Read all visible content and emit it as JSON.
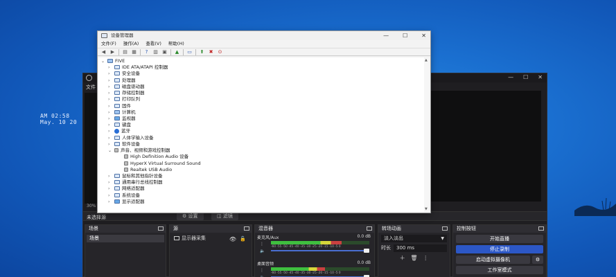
{
  "desktop": {
    "clock_time": "AM 02:58",
    "clock_date": "May. 10 20"
  },
  "obs": {
    "menu_file": "文件",
    "zoom": "30%",
    "no_source_selected": "未选择源",
    "properties_button": "设置",
    "filters_button": "滤镜",
    "docks": {
      "scenes": {
        "title": "场景",
        "items": [
          "场景"
        ]
      },
      "sources": {
        "title": "源",
        "items": [
          "显示器采集"
        ]
      },
      "mixer": {
        "title": "混音器",
        "channels": [
          {
            "name": "麦克风/Aux",
            "db": "0.0 dB",
            "level": 0.72
          },
          {
            "name": "桌面音频",
            "db": "0.0 dB",
            "level": 0.55
          }
        ],
        "scale": "-60 -55 -50 -45 -40 -35 -30 -25 -20 -15 -10 -5 0"
      },
      "transitions": {
        "title": "转场动画",
        "selected": "淡入淡出",
        "duration_label": "时长",
        "duration_value": "300 ms"
      },
      "controls": {
        "title": "控制按钮",
        "start_streaming": "开始直播",
        "stop_recording": "停止录制",
        "start_virtual_camera": "启动虚拟摄像机",
        "studio_mode": "工作室模式"
      }
    }
  },
  "device_manager": {
    "title": "设备管理器",
    "menu": [
      "文件(F)",
      "操作(A)",
      "查看(V)",
      "帮助(H)"
    ],
    "root": "FIVE",
    "nodes": [
      {
        "label": "IDE ATA/ATAPI 控制器",
        "level": 1,
        "expander": "›",
        "icon": "controller-icon"
      },
      {
        "label": "安全设备",
        "level": 1,
        "expander": "›",
        "icon": "security-device-icon"
      },
      {
        "label": "处理器",
        "level": 1,
        "expander": "›",
        "icon": "cpu-icon"
      },
      {
        "label": "磁盘驱动器",
        "level": 1,
        "expander": "›",
        "icon": "disk-icon"
      },
      {
        "label": "存储控制器",
        "level": 1,
        "expander": "›",
        "icon": "storage-icon"
      },
      {
        "label": "打印队列",
        "level": 1,
        "expander": "›",
        "icon": "printer-icon"
      },
      {
        "label": "固件",
        "level": 1,
        "expander": "›",
        "icon": "firmware-icon"
      },
      {
        "label": "计算机",
        "level": 1,
        "expander": "›",
        "icon": "computer-icon"
      },
      {
        "label": "监视器",
        "level": 1,
        "expander": "›",
        "icon": "monitor-icon"
      },
      {
        "label": "键盘",
        "level": 1,
        "expander": "›",
        "icon": "keyboard-icon"
      },
      {
        "label": "蓝牙",
        "level": 1,
        "expander": "›",
        "icon": "bluetooth-icon"
      },
      {
        "label": "人体学输入设备",
        "level": 1,
        "expander": "›",
        "icon": "hid-icon"
      },
      {
        "label": "软件设备",
        "level": 1,
        "expander": "›",
        "icon": "software-device-icon"
      },
      {
        "label": "声音、视频和游戏控制器",
        "level": 1,
        "expander": "⌄",
        "icon": "audio-icon"
      },
      {
        "label": "High Definition Audio 设备",
        "level": 2,
        "expander": "",
        "icon": "speaker-icon"
      },
      {
        "label": "HyperX Virtual Surround Sound",
        "level": 2,
        "expander": "",
        "icon": "speaker-icon"
      },
      {
        "label": "Realtek USB Audio",
        "level": 2,
        "expander": "",
        "icon": "speaker-icon"
      },
      {
        "label": "鼠标和其他指针设备",
        "level": 1,
        "expander": "›",
        "icon": "mouse-icon"
      },
      {
        "label": "通用串行总线控制器",
        "level": 1,
        "expander": "›",
        "icon": "usb-icon"
      },
      {
        "label": "网络适配器",
        "level": 1,
        "expander": "›",
        "icon": "network-icon"
      },
      {
        "label": "系统设备",
        "level": 1,
        "expander": "›",
        "icon": "system-device-icon"
      },
      {
        "label": "显示适配器",
        "level": 1,
        "expander": "›",
        "icon": "display-adapter-icon"
      }
    ]
  }
}
